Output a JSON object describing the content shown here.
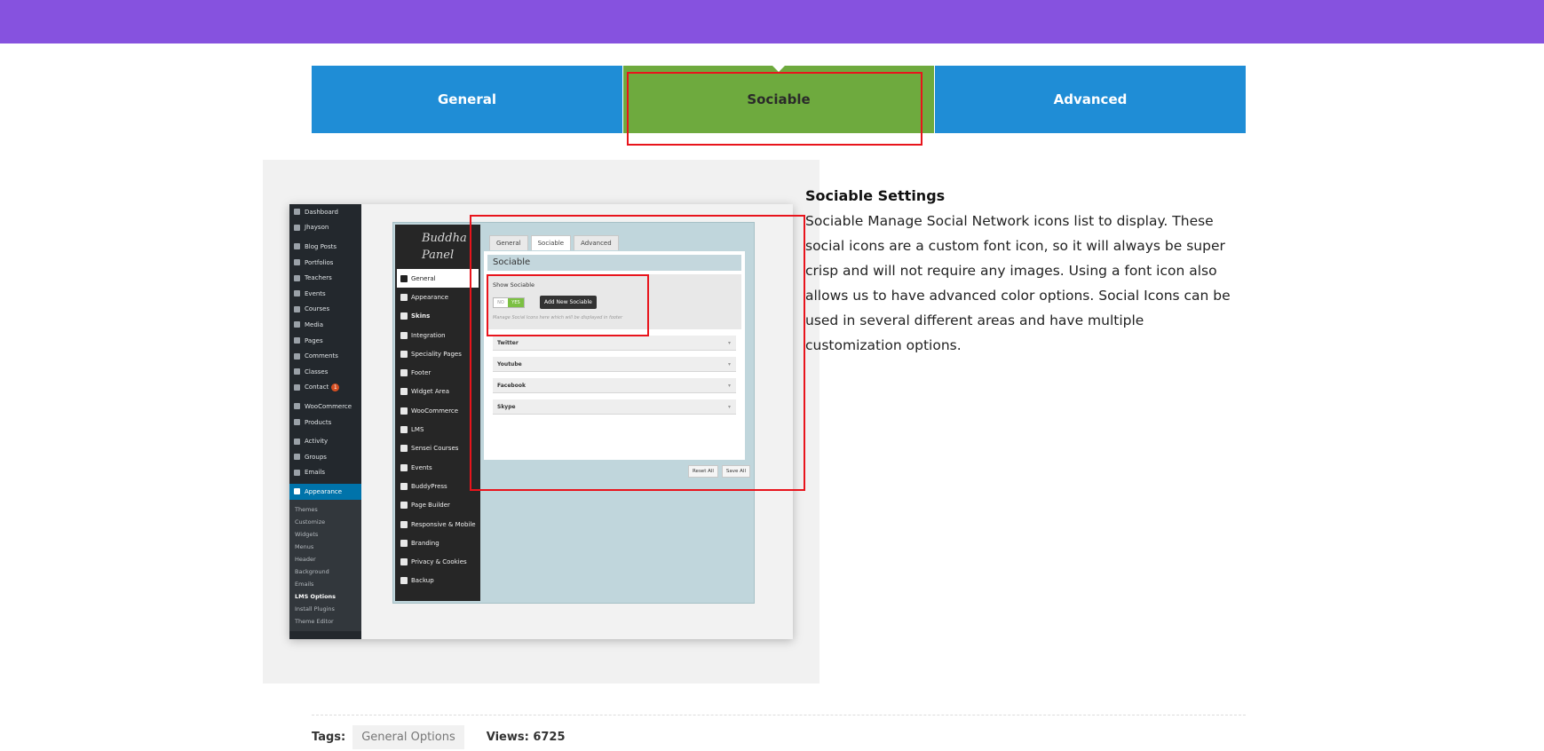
{
  "colors": {
    "topbar": "#8652df",
    "tab_blue": "#1f8dd6",
    "tab_green": "#6eaa3e",
    "highlight_red": "#e8141c"
  },
  "tabs": [
    {
      "label": "General",
      "active": false
    },
    {
      "label": "Sociable",
      "active": true
    },
    {
      "label": "Advanced",
      "active": false
    }
  ],
  "screenshot": {
    "wp_menu": [
      {
        "label": "Dashboard",
        "icon": "dashboard-icon"
      },
      {
        "label": "Jhayson",
        "icon": "jetpack-icon"
      },
      {
        "label": "Blog Posts",
        "icon": "pin-icon"
      },
      {
        "label": "Portfolios",
        "icon": "portfolio-icon"
      },
      {
        "label": "Teachers",
        "icon": "users-icon"
      },
      {
        "label": "Events",
        "icon": "calendar-icon"
      },
      {
        "label": "Courses",
        "icon": "book-icon"
      },
      {
        "label": "Media",
        "icon": "media-icon"
      },
      {
        "label": "Pages",
        "icon": "page-icon"
      },
      {
        "label": "Comments",
        "icon": "comment-icon"
      },
      {
        "label": "Classes",
        "icon": "calendar-icon"
      },
      {
        "label": "Contact",
        "icon": "mail-icon",
        "badge": "1"
      },
      {
        "label": "WooCommerce",
        "icon": "woo-icon"
      },
      {
        "label": "Products",
        "icon": "products-icon"
      },
      {
        "label": "Activity",
        "icon": "activity-icon"
      },
      {
        "label": "Groups",
        "icon": "groups-icon"
      },
      {
        "label": "Emails",
        "icon": "email-icon"
      }
    ],
    "wp_active": {
      "label": "Appearance",
      "icon": "brush-icon"
    },
    "wp_submenu": [
      "Themes",
      "Customize",
      "Widgets",
      "Menus",
      "Header",
      "Background",
      "Emails",
      "LMS Options",
      "Install Plugins",
      "Theme Editor"
    ],
    "panel_logo_line1": "Buddha",
    "panel_logo_line2": "Panel",
    "panel_nav": [
      {
        "label": "General",
        "icon": "wrench-icon"
      },
      {
        "label": "Appearance",
        "icon": "layout-icon"
      },
      {
        "label": "Skins",
        "icon": "gear-icon"
      },
      {
        "label": "Integration",
        "icon": "window-icon"
      },
      {
        "label": "Speciality Pages",
        "icon": "grid-icon"
      },
      {
        "label": "Footer",
        "icon": "footer-icon"
      },
      {
        "label": "Widget Area",
        "icon": "widget-icon"
      },
      {
        "label": "WooCommerce",
        "icon": "cart-icon"
      },
      {
        "label": "LMS",
        "icon": "graduation-icon"
      },
      {
        "label": "Sensei Courses",
        "icon": "book-icon"
      },
      {
        "label": "Events",
        "icon": "calendar-icon"
      },
      {
        "label": "BuddyPress",
        "icon": "buddypress-icon"
      },
      {
        "label": "Page Builder",
        "icon": "builder-icon"
      },
      {
        "label": "Responsive & Mobile",
        "icon": "mobile-icon"
      },
      {
        "label": "Branding",
        "icon": "bulb-icon"
      },
      {
        "label": "Privacy & Cookies",
        "icon": "tools-icon"
      },
      {
        "label": "Backup",
        "icon": "backup-icon"
      }
    ],
    "panel_tabs": [
      "General",
      "Sociable",
      "Advanced"
    ],
    "section_title": "Sociable",
    "show_label": "Show Sociable",
    "toggle_off": "NO",
    "toggle_on": "YES",
    "add_button": "Add New Sociable",
    "help_text": "Manage Social Icons here which will be displayed in footer",
    "accordions": [
      "Twitter",
      "Youtube",
      "Facebook",
      "Skype"
    ],
    "reset_button": "Reset All",
    "save_button": "Save All"
  },
  "description": {
    "title": "Sociable Settings",
    "body": "Sociable Manage Social Network icons list to display. These social icons are a custom font icon, so it will always be super crisp and will not require any images. Using a font icon also allows us to have advanced color options. Social Icons can be used in several different areas and have multiple customization options."
  },
  "footer": {
    "tags_label": "Tags:",
    "tag": "General Options",
    "views_label": "Views: 6725"
  }
}
